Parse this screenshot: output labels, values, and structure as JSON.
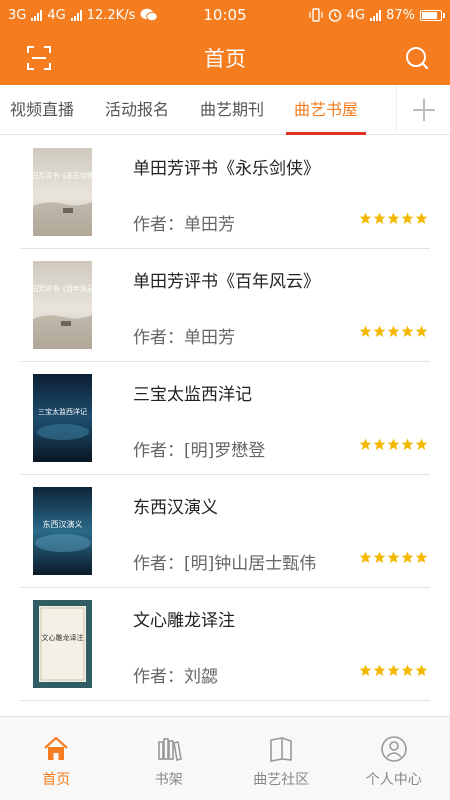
{
  "status_bar": {
    "network1": "3G",
    "network2": "4G",
    "speed": "12.2K/s",
    "time": "10:05",
    "network3": "4G",
    "battery": "87%",
    "battery_level": 0.87
  },
  "header": {
    "title": "首页"
  },
  "tabs": [
    {
      "label": "视频直播",
      "active": false
    },
    {
      "label": "活动报名",
      "active": false
    },
    {
      "label": "曲艺期刊",
      "active": false
    },
    {
      "label": "曲艺书屋",
      "active": true
    }
  ],
  "books": [
    {
      "title": "单田芳评书《永乐剑侠》",
      "author": "作者：单田芳",
      "rating": 5,
      "cover_text": "单田芳评书《永乐剑侠》"
    },
    {
      "title": "单田芳评书《百年风云》",
      "author": "作者：单田芳",
      "rating": 5,
      "cover_text": "单田芳评书《百年风云》"
    },
    {
      "title": "三宝太监西洋记",
      "author": "作者：[明]罗懋登",
      "rating": 5,
      "cover_text": "三宝太监西洋记"
    },
    {
      "title": "东西汉演义",
      "author": "作者：[明]钟山居士甄伟",
      "rating": 5,
      "cover_text": "东西汉演义"
    },
    {
      "title": "文心雕龙译注",
      "author": "作者：刘勰",
      "rating": 5,
      "cover_text": "文心雕龙译注"
    }
  ],
  "bottom_nav": [
    {
      "label": "首页",
      "icon": "home-icon",
      "active": true
    },
    {
      "label": "书架",
      "icon": "bookshelf-icon",
      "active": false
    },
    {
      "label": "曲艺社区",
      "icon": "community-icon",
      "active": false
    },
    {
      "label": "个人中心",
      "icon": "user-icon",
      "active": false
    }
  ],
  "colors": {
    "accent": "#f57d20",
    "tab_underline": "#e0301e",
    "star": "#f5b800"
  }
}
